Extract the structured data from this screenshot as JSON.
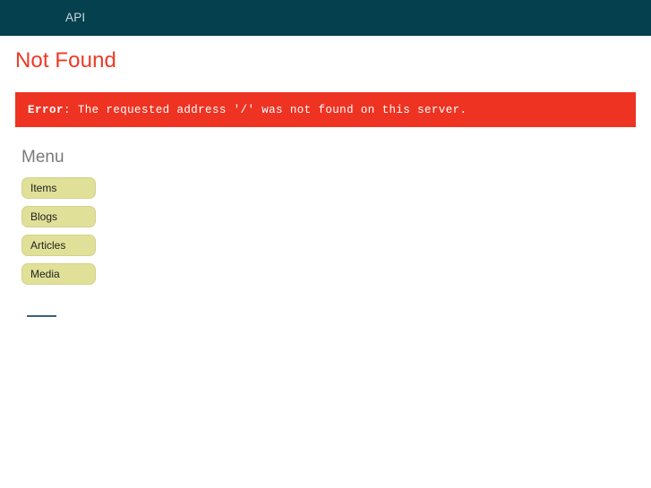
{
  "colors": {
    "topbar_bg": "#05404f",
    "topbar_text": "#c9d8dc",
    "title": "#ec3b26",
    "error_bg": "#ee3322",
    "error_text": "#ffffff",
    "menu_heading": "#7a7a7a",
    "menu_button_bg": "#e0e098",
    "menu_button_border": "#d2d28c",
    "link": "#36647a",
    "page_bg": "#ffffff"
  },
  "topbar": {
    "brand": "API"
  },
  "page": {
    "title": "Not Found"
  },
  "error": {
    "label": "Error",
    "separator": ": ",
    "message": "The requested address '/' was not found on this server.",
    "full_text": "Error: The requested address '/' was not found on this server."
  },
  "menu": {
    "heading": "Menu",
    "items": [
      {
        "label": "Items"
      },
      {
        "label": "Blogs"
      },
      {
        "label": "Articles"
      },
      {
        "label": "Media"
      }
    ]
  },
  "footer": {
    "link_label": ""
  }
}
